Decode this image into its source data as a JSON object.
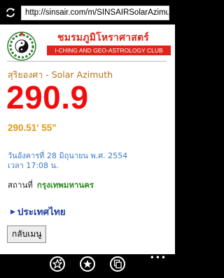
{
  "browser": {
    "url": "http://sinsair.com/m/SINSAIRSolarAzimuth"
  },
  "header": {
    "club_name_th": "ชมรมภูมิโหราศาสตร์",
    "club_name_en": "I-CHING AND GEO-ASTROLOGY CLUB"
  },
  "main": {
    "heading": "สุริยองศา - Solar Azimuth",
    "azimuth_value": "290.9",
    "azimuth_dms": "290.51' 55\"",
    "date_line": "วันอังคารที่ 28 มิถุนายน พ.ศ. 2554",
    "time_line": "เวลา 17:08 น.",
    "location_label": "สถานที่",
    "location_value": "กรุงเทพมหานคร",
    "country_link": "ประเทศไทย",
    "back_button": "กลับเมนู"
  },
  "appbar": {
    "more": "•••"
  },
  "colors": {
    "brand_red": "#e0261b",
    "value_red": "#f20c0c",
    "dms_orange": "#e09a13",
    "heading_brown": "#b8741a",
    "date_blue": "#3a79c4",
    "location_green": "#2a8a1f",
    "link_blue": "#1e3fa5"
  },
  "icons": [
    "refresh-icon",
    "logo-icon",
    "caret-right-icon",
    "add-favorite-icon",
    "favorites-icon",
    "tabs-icon"
  ]
}
